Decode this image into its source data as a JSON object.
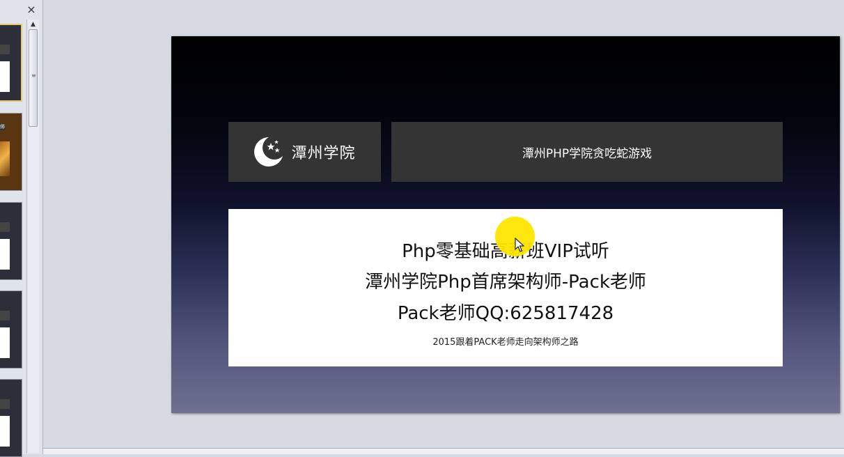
{
  "pane": {
    "close_glyph": "×",
    "thumb_label": "师",
    "scroll_up": "▲",
    "grip": "≡"
  },
  "slide": {
    "logo_icon": "moon-stars-icon",
    "logo_text": "潭州学院",
    "title": "潭州PHP学院贪吃蛇游戏",
    "lines": [
      "Php零基础高薪班VIP试听",
      "潭州学院Php首席架构师-Pack老师",
      "Pack老师QQ:625817428"
    ],
    "tagline": "2015跟着PACK老师走向架构师之路"
  },
  "colors": {
    "panel": "#343434",
    "highlight": "#ffe600",
    "selected_thumb": "#e9c86c"
  }
}
